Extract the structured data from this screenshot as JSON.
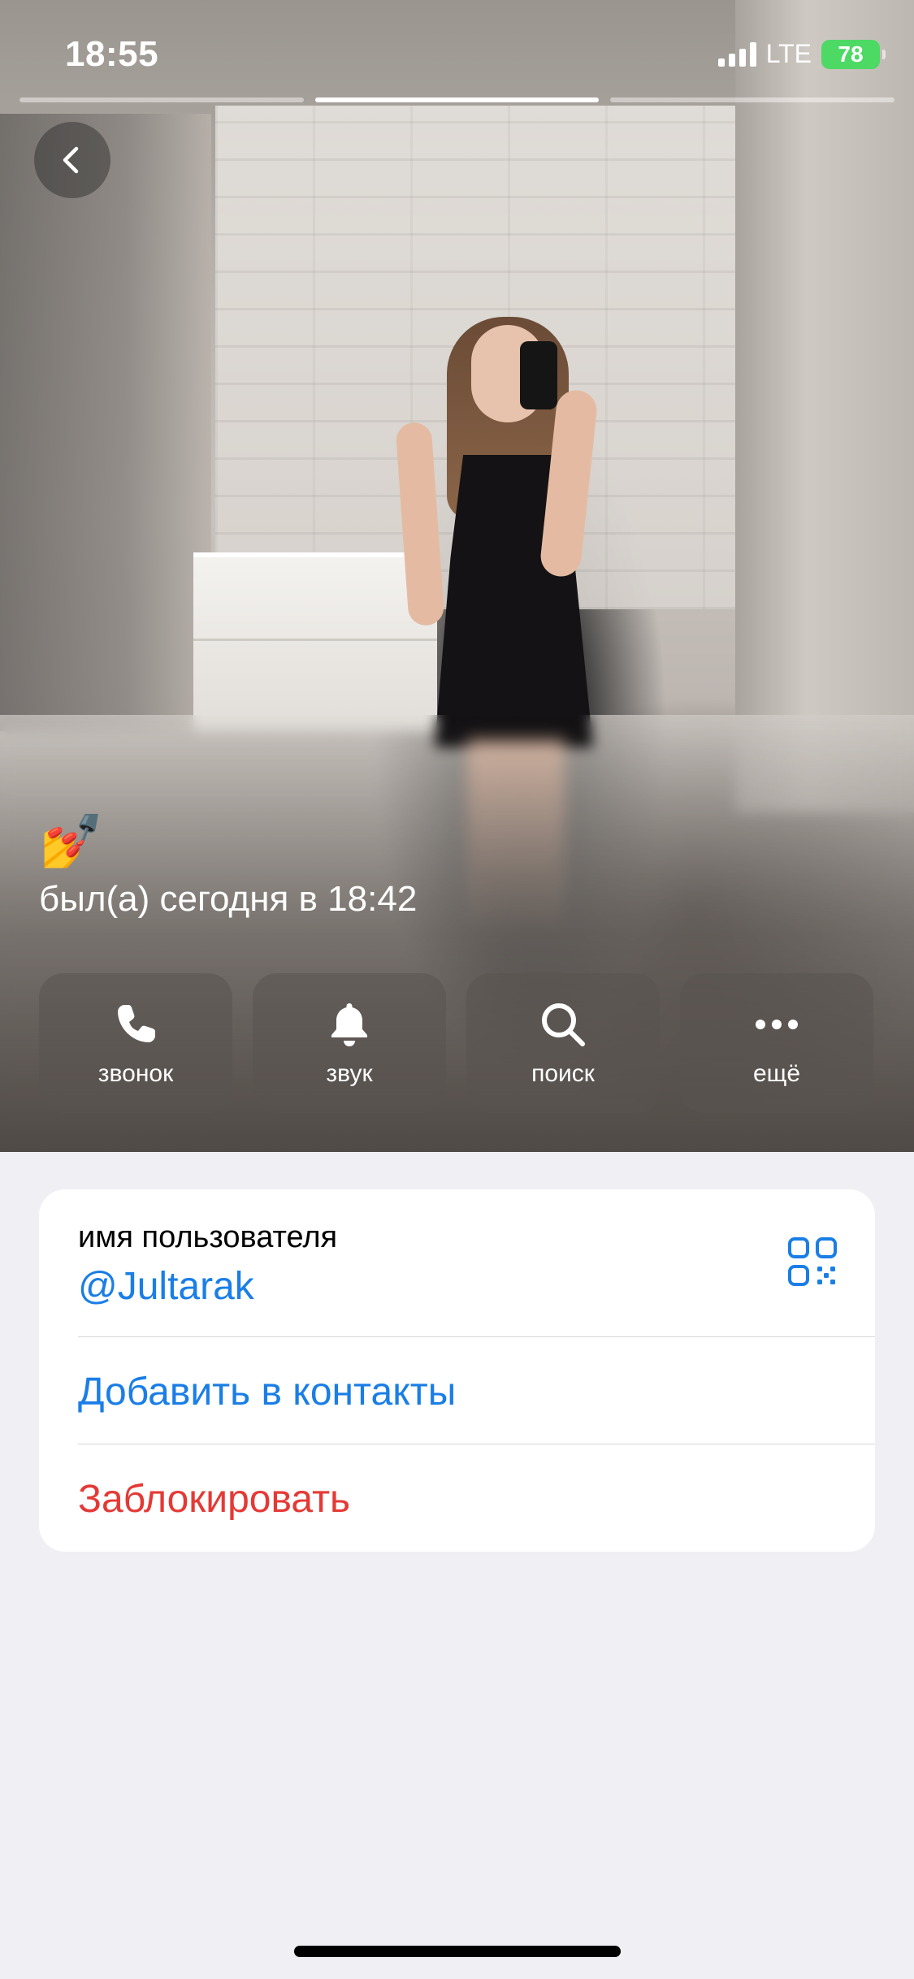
{
  "status_bar": {
    "time": "18:55",
    "network": "LTE",
    "battery": "78"
  },
  "story": {
    "segments": 3,
    "active_segment": 2
  },
  "profile": {
    "emoji": "💅",
    "last_seen": "был(а) сегодня в 18:42"
  },
  "actions": {
    "call": "звонок",
    "sound": "звук",
    "search": "поиск",
    "more": "ещё"
  },
  "info": {
    "username_label": "имя пользователя",
    "username_value": "@Jultarak",
    "add_contact": "Добавить в контакты",
    "block": "Заблокировать"
  },
  "colors": {
    "link": "#1a7ee6",
    "destructive": "#e53935",
    "battery": "#4cd964",
    "background": "#efeff4"
  },
  "icons": [
    "chevron-left-icon",
    "phone-icon",
    "bell-icon",
    "search-icon",
    "more-icon",
    "qr-code-icon"
  ]
}
